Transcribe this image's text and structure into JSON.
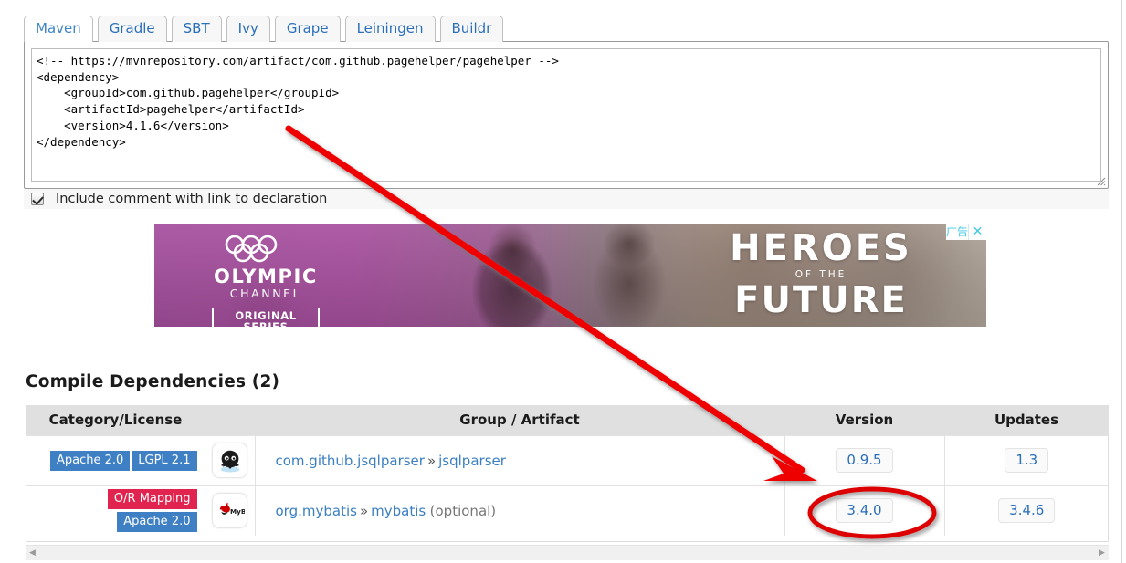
{
  "tabs": [
    {
      "label": "Maven",
      "active": true
    },
    {
      "label": "Gradle",
      "active": false
    },
    {
      "label": "SBT",
      "active": false
    },
    {
      "label": "Ivy",
      "active": false
    },
    {
      "label": "Grape",
      "active": false
    },
    {
      "label": "Leiningen",
      "active": false
    },
    {
      "label": "Buildr",
      "active": false
    }
  ],
  "code": {
    "value": "<!-- https://mvnrepository.com/artifact/com.github.pagehelper/pagehelper -->\n<dependency>\n    <groupId>com.github.pagehelper</groupId>\n    <artifactId>pagehelper</artifactId>\n    <version>4.1.6</version>\n</dependency>",
    "resize_grip_icon": "resize-grip-icon"
  },
  "checkbox": {
    "label": "Include comment with link to declaration",
    "checked": true
  },
  "ad": {
    "brand_name": "OLYMPIC",
    "brand_sub": "CHANNEL",
    "brand_tagline": "ORIGINAL SERIES",
    "headline_1": "HEROES",
    "headline_2": "OF THE",
    "headline_3": "FUTURE",
    "ad_tag_label": "广告",
    "close_label": "✕",
    "rings_icon": "olympic-rings-icon",
    "ad_tag_color": "#3fc9e2"
  },
  "section": {
    "title": "Compile Dependencies (2)"
  },
  "table": {
    "columns": [
      "Category/License",
      "",
      "Group / Artifact",
      "Version",
      "Updates"
    ],
    "rows": [
      {
        "licenses": [
          [
            "Apache 2.0",
            "blue"
          ],
          [
            "LGPL 2.1",
            "blue"
          ]
        ],
        "icon": "github-octocat-icon",
        "group": "com.github.jsqlparser",
        "separator": "»",
        "artifact": "jsqlparser",
        "optional": "",
        "version": "0.9.5",
        "updates": "1.3"
      },
      {
        "licenses": [
          [
            "O/R Mapping",
            "red"
          ],
          [
            "Apache 2.0",
            "blue"
          ]
        ],
        "icon": "mybatis-logo-icon",
        "group": "org.mybatis",
        "separator": "»",
        "artifact": "mybatis",
        "optional": "(optional)",
        "version": "3.4.0",
        "updates": "3.4.6"
      }
    ]
  },
  "scrollbar": {
    "left_arrow": "◀",
    "right_arrow": "▶"
  },
  "annotations": {
    "arrow_color": "#ee0000",
    "ellipse_color": "#dd0000"
  },
  "colors": {
    "link": "#3a7fc1",
    "badge_blue": "#3f80c4",
    "badge_red": "#e0244f",
    "header_bg": "#e0e0e0"
  }
}
